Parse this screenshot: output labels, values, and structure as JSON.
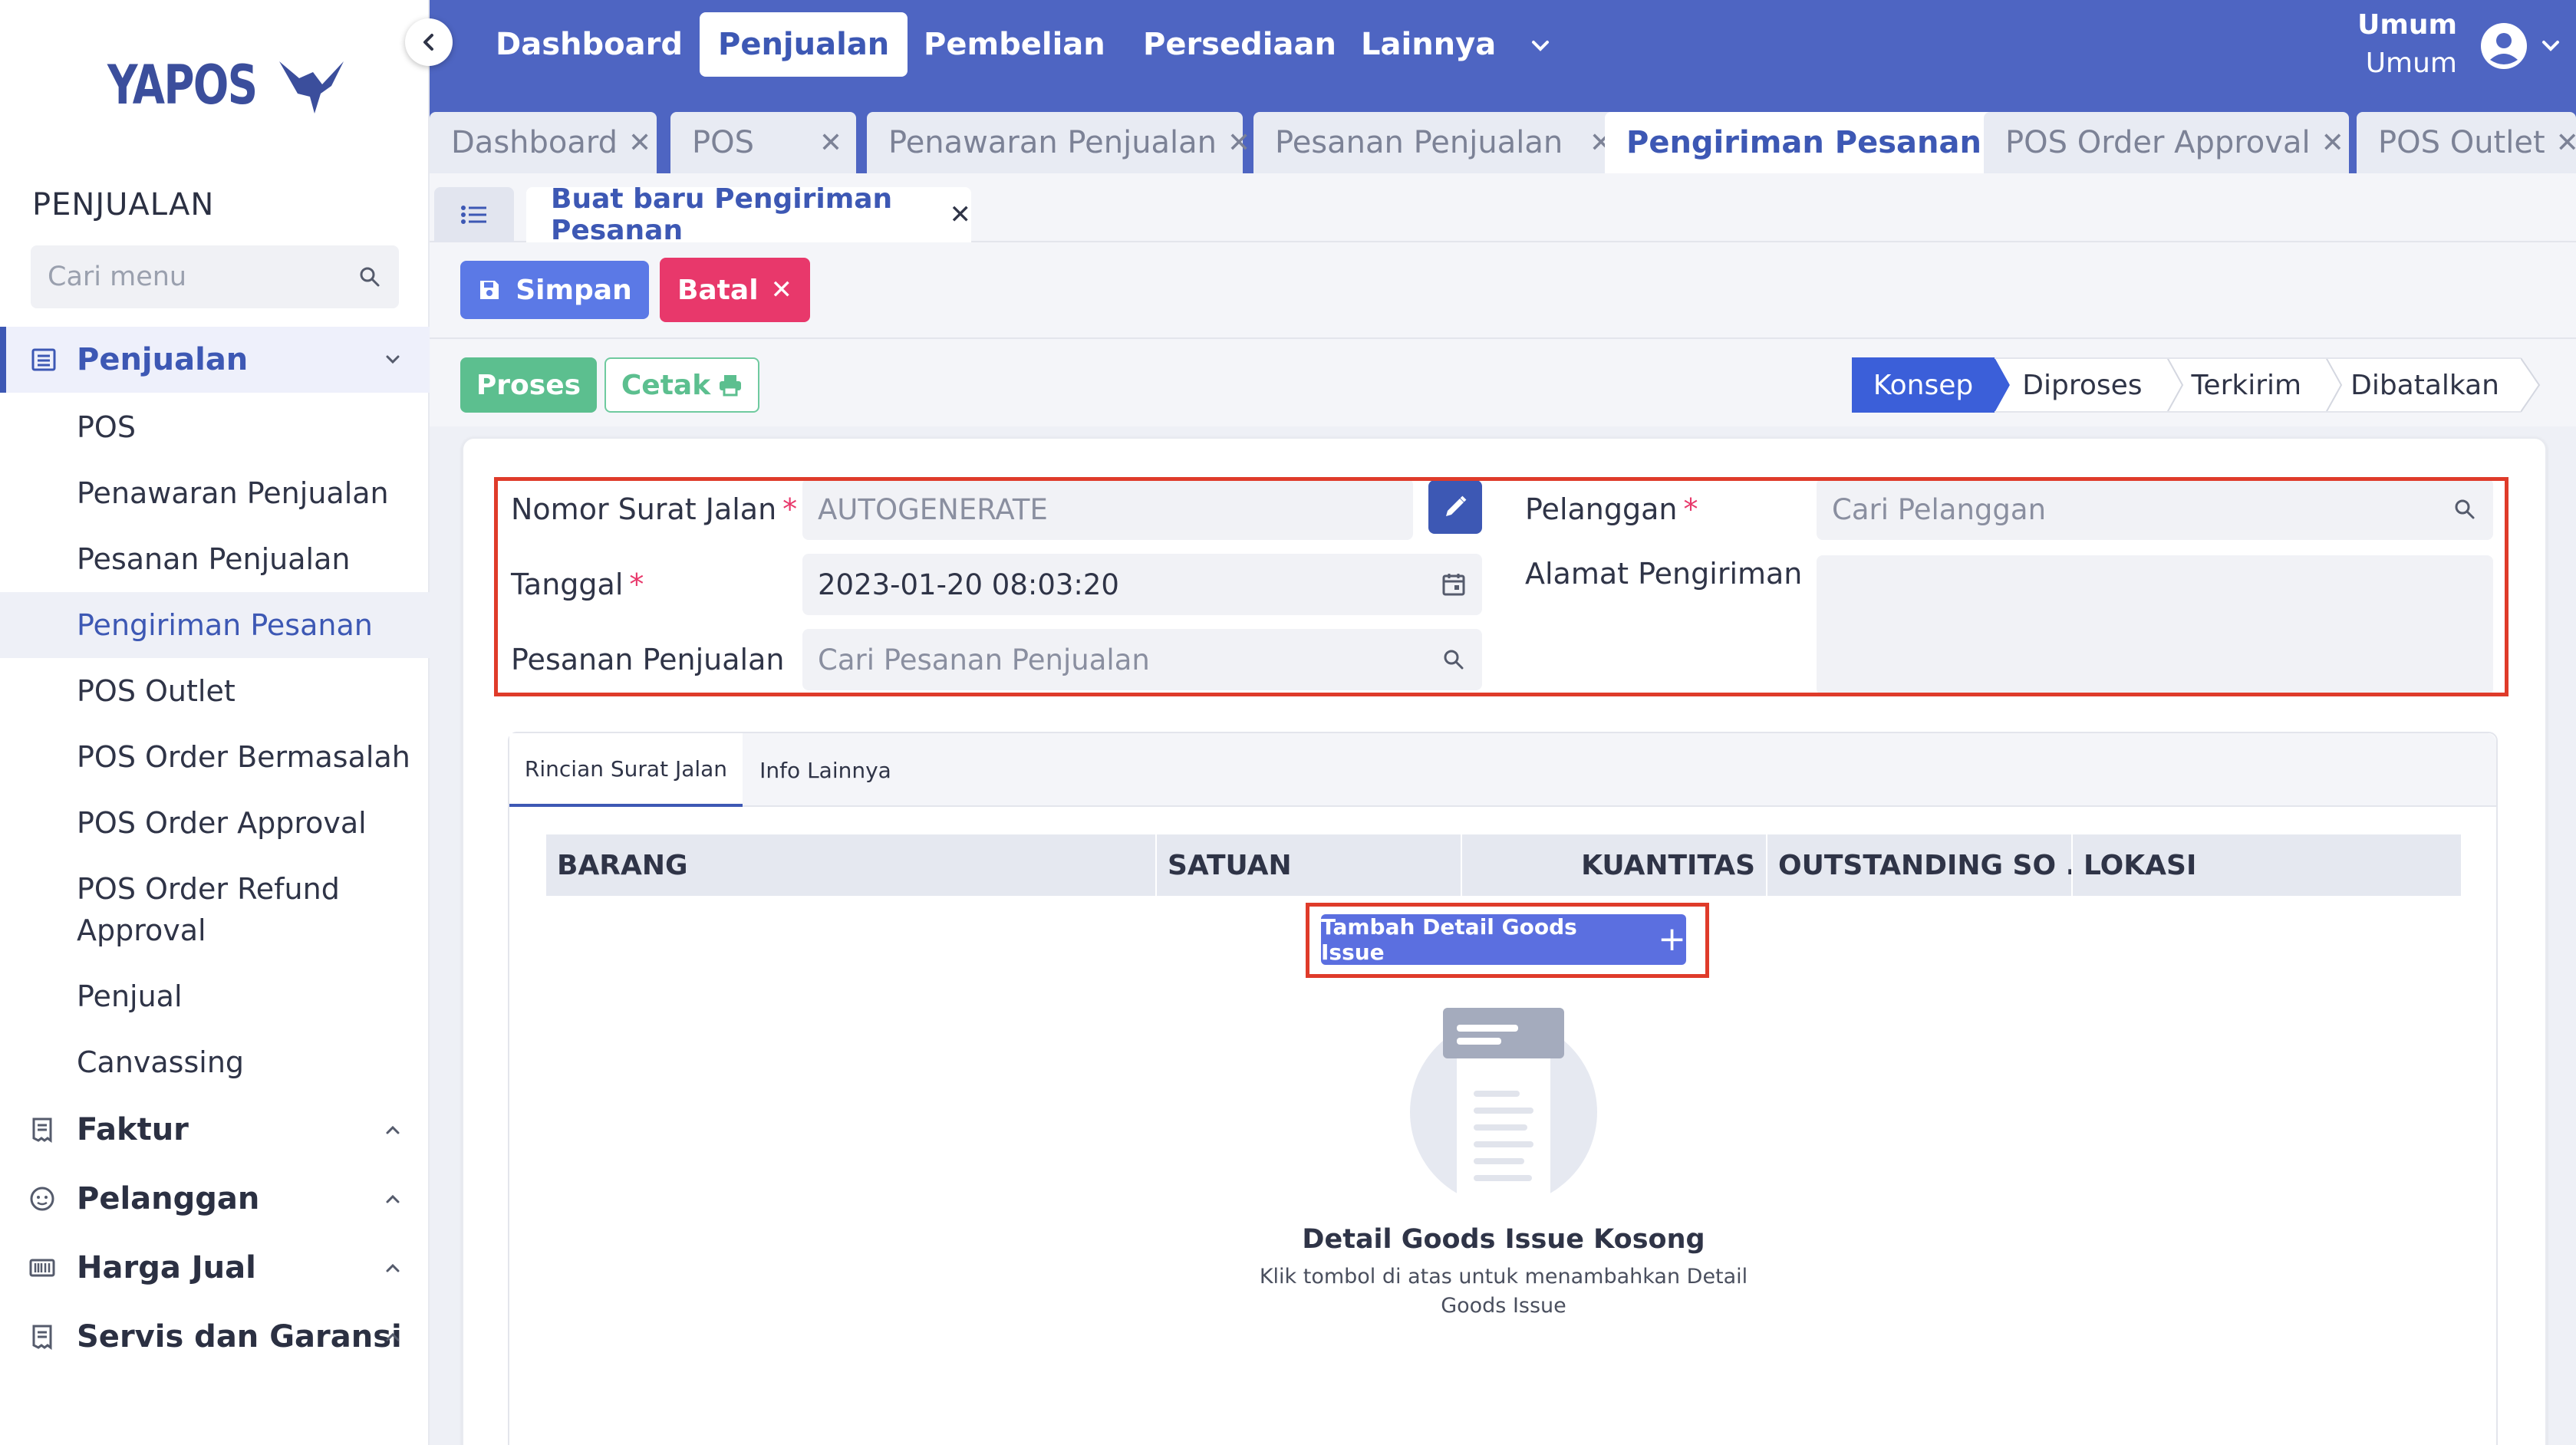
{
  "brand": {
    "logo_text": "YAPOS"
  },
  "sidebar": {
    "section_title": "PENJUALAN",
    "search_placeholder": "Cari menu",
    "groups": [
      {
        "label": "Penjualan",
        "icon": "list-icon",
        "expanded": true
      },
      {
        "label": "Faktur",
        "icon": "receipt-icon",
        "expanded": false
      },
      {
        "label": "Pelanggan",
        "icon": "face-icon",
        "expanded": false
      },
      {
        "label": "Harga Jual",
        "icon": "barcode-icon",
        "expanded": false
      },
      {
        "label": "Servis dan Garansi",
        "icon": "receipt-icon",
        "expanded": false
      }
    ],
    "sub_items": [
      "POS",
      "Penawaran Penjualan",
      "Pesanan Penjualan",
      "Pengiriman Pesanan",
      "POS Outlet",
      "POS Order Bermasalah",
      "POS Order Approval",
      "POS Order Refund",
      "Approval",
      "Penjual",
      "Canvassing"
    ],
    "active_sub_item": "Pengiriman Pesanan"
  },
  "topbar": {
    "nav": [
      "Dashboard",
      "Penjualan",
      "Pembelian",
      "Persediaan",
      "Lainnya"
    ],
    "active_nav": "Penjualan",
    "user_name": "Umum",
    "user_role": "Umum"
  },
  "tabs": [
    "Dashboard",
    "POS",
    "Penawaran Penjualan",
    "Pesanan Penjualan",
    "Pengiriman Pesanan",
    "POS Order Approval",
    "POS Outlet"
  ],
  "active_tab": "Pengiriman Pesanan",
  "document_tab": "Buat baru Pengiriman Pesanan",
  "actions": {
    "save": "Simpan",
    "cancel": "Batal",
    "process": "Proses",
    "print": "Cetak"
  },
  "status_steps": [
    "Konsep",
    "Diproses",
    "Terkirim",
    "Dibatalkan"
  ],
  "active_status": "Konsep",
  "form": {
    "nomor_label": "Nomor Surat Jalan",
    "nomor_value": "AUTOGENERATE",
    "tanggal_label": "Tanggal",
    "tanggal_value": "2023-01-20  08:03:20",
    "pesanan_label": "Pesanan Penjualan",
    "pesanan_placeholder": "Cari Pesanan Penjualan",
    "pelanggan_label": "Pelanggan",
    "pelanggan_placeholder": "Cari Pelanggan",
    "alamat_label": "Alamat Pengiriman",
    "required_mark": "*"
  },
  "detail": {
    "tabs": [
      "Rincian Surat Jalan",
      "Info Lainnya"
    ],
    "active_tab": "Rincian Surat Jalan",
    "columns": [
      "BARANG",
      "SATUAN",
      "KUANTITAS",
      "OUTSTANDING SO ...",
      "LOKASI"
    ],
    "add_button": "Tambah Detail Goods Issue",
    "empty_title": "Detail Goods Issue Kosong",
    "empty_desc": "Klik tombol di atas untuk menambahkan Detail Goods Issue"
  },
  "colors": {
    "primary": "#4e65c2",
    "accent_blue": "#3d58b4",
    "save": "#5b79e6",
    "cancel": "#e8386b",
    "process": "#5cbf8f",
    "highlight": "#df3b2a"
  }
}
